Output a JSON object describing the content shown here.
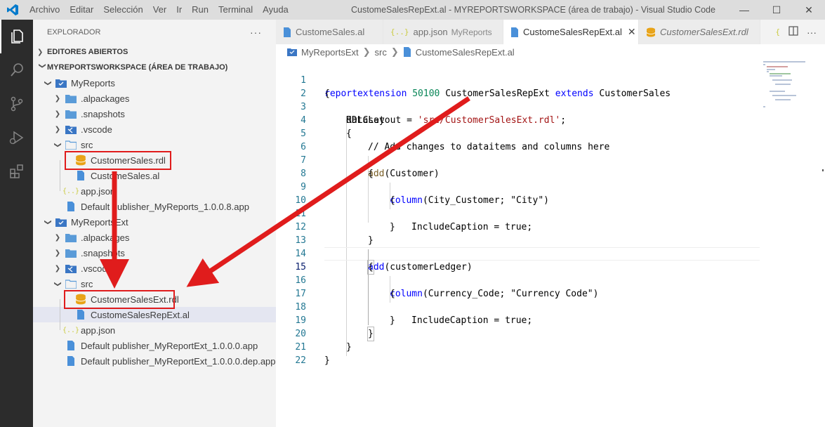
{
  "titlebar": {
    "menu": [
      "Archivo",
      "Editar",
      "Selección",
      "Ver",
      "Ir",
      "Run",
      "Terminal",
      "Ayuda"
    ],
    "title": "CustomeSalesRepExt.al - MYREPORTSWORKSPACE (área de trabajo) - Visual Studio Code"
  },
  "sidebar": {
    "header": "EXPLORADOR",
    "open_editors": "EDITORES ABIERTOS",
    "workspace": "MYREPORTSWORKSPACE (ÁREA DE TRABAJO)",
    "tree": [
      {
        "label": "MyReports",
        "icon": "folder-project-icon"
      },
      {
        "label": ".alpackages",
        "icon": "folder-icon"
      },
      {
        "label": ".snapshots",
        "icon": "folder-icon"
      },
      {
        "label": ".vscode",
        "icon": "vscode-folder-icon"
      },
      {
        "label": "src",
        "icon": "folder-open-icon"
      },
      {
        "label": "CustomerSales.rdl",
        "icon": "database-icon"
      },
      {
        "label": "CustomeSales.al",
        "icon": "file-icon"
      },
      {
        "label": "app.json",
        "icon": "json-icon"
      },
      {
        "label": "Default publisher_MyReports_1.0.0.8.app",
        "icon": "file-icon"
      },
      {
        "label": "MyReportsExt",
        "icon": "folder-project-icon"
      },
      {
        "label": ".alpackages",
        "icon": "folder-icon"
      },
      {
        "label": ".snapshots",
        "icon": "folder-icon"
      },
      {
        "label": ".vscode",
        "icon": "vscode-folder-icon"
      },
      {
        "label": "src",
        "icon": "folder-open-icon"
      },
      {
        "label": "CustomerSalesExt.rdl",
        "icon": "database-icon"
      },
      {
        "label": "CustomeSalesRepExt.al",
        "icon": "file-icon"
      },
      {
        "label": "app.json",
        "icon": "json-icon"
      },
      {
        "label": "Default publisher_MyReportExt_1.0.0.0.app",
        "icon": "file-icon"
      },
      {
        "label": "Default publisher_MyReportExt_1.0.0.0.dep.app",
        "icon": "file-icon"
      }
    ]
  },
  "tabs": [
    {
      "label": "CustomeSales.al",
      "desc": ""
    },
    {
      "label": "app.json",
      "desc": "MyReports"
    },
    {
      "label": "CustomeSalesRepExt.al",
      "desc": ""
    },
    {
      "label": "CustomerSalesExt.rdl",
      "desc": ""
    }
  ],
  "breadcrumb": [
    "MyReportsExt",
    "src",
    "CustomeSalesRepExt.al"
  ],
  "code": {
    "l1": {
      "num": "1",
      "a": "reportextension",
      "b": "50100",
      "c": "CustomerSalesRepExt",
      "d": "extends",
      "e": "CustomerSales"
    },
    "l2": {
      "num": "2",
      "t": "{"
    },
    "l3": {
      "num": "3",
      "a": "RDLCLayout = ",
      "b": "'src/CustomerSalesExt.rdl'",
      "c": ";"
    },
    "l4": {
      "num": "4",
      "t": "dataset"
    },
    "l5": {
      "num": "5",
      "t": "{"
    },
    "l6": {
      "num": "6",
      "t": "// Add changes to dataitems and columns here"
    },
    "l7": {
      "num": "7",
      "a": "add",
      "b": "(Customer)"
    },
    "l8": {
      "num": "8",
      "t": "{"
    },
    "l9": {
      "num": "9",
      "a": "column",
      "b": "(City_Customer; ",
      "c": "\"City\"",
      "d": ")"
    },
    "l10": {
      "num": "10",
      "t": "{"
    },
    "l11": {
      "num": "11",
      "a": "IncludeCaption = ",
      "b": "true",
      "c": ";"
    },
    "l12": {
      "num": "12",
      "t": "}"
    },
    "l13": {
      "num": "13",
      "t": "}"
    },
    "l14": {
      "num": "14",
      "a": "add",
      "b": "(customerLedger)"
    },
    "l15": {
      "num": "15",
      "t": "{"
    },
    "l16": {
      "num": "16",
      "a": "column",
      "b": "(Currency_Code; ",
      "c": "\"Currency Code\"",
      "d": ")"
    },
    "l17": {
      "num": "17",
      "t": "{"
    },
    "l18": {
      "num": "18",
      "a": "IncludeCaption = ",
      "b": "true",
      "c": ";"
    },
    "l19": {
      "num": "19",
      "t": "}"
    },
    "l20": {
      "num": "20",
      "t": "}"
    },
    "l21": {
      "num": "21",
      "t": "}"
    },
    "l22": {
      "num": "22",
      "t": "}"
    }
  },
  "colors": {
    "accent": "#007acc",
    "annotation": "#e01c1c",
    "keyword": "#0000ff",
    "string": "#a31515",
    "comment": "#008000"
  }
}
